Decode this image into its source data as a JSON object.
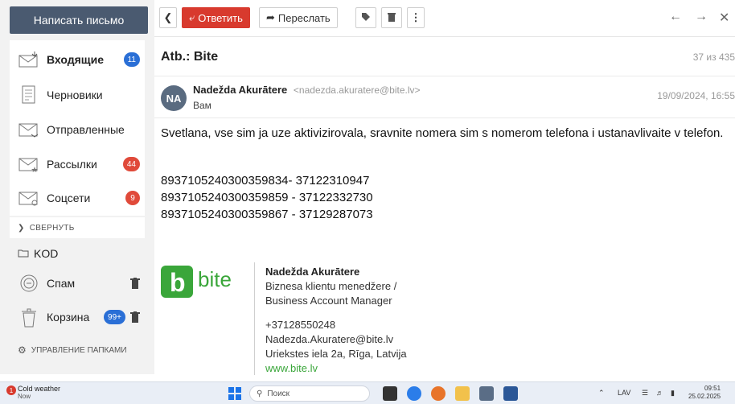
{
  "sidebar": {
    "compose_label": "Написать письмо",
    "folders": [
      {
        "label": "Входящие",
        "badge": "11",
        "badge_color": "#2a6fd6",
        "icon": "inbox-icon",
        "bold": true
      },
      {
        "label": "Черновики",
        "icon": "drafts-icon"
      },
      {
        "label": "Отправленные",
        "icon": "sent-icon"
      },
      {
        "label": "Рассылки",
        "badge": "44",
        "badge_color": "#e04a3a",
        "icon": "newsletters-icon"
      },
      {
        "label": "Соцсети",
        "badge": "9",
        "badge_color": "#e04a3a",
        "icon": "social-icon"
      }
    ],
    "collapse_label": "СВЕРНУТЬ",
    "custom_folder": "KOD",
    "spam_label": "Спам",
    "trash_label": "Корзина",
    "trash_badge": "99+",
    "manage_label": "УПРАВЛЕНИЕ ПАПКАМИ"
  },
  "toolbar": {
    "reply_label": "Ответить",
    "forward_label": "Переслать"
  },
  "message": {
    "subject": "Atb.: Bite",
    "counter": "37 из 435",
    "avatar_initials": "NA",
    "sender_name": "Nadežda Akurātere",
    "sender_email": "<nadezda.akuratere@bite.lv>",
    "to": "Вам",
    "date": "19/09/2024, 16:55",
    "body": "Svetlana, vse sim ja uze aktivizirovala, sravnite nomera sim s nomerom telefona i ustanavlivaite v telefon.",
    "sim_lines": [
      "8937105240300359834-  37122310947",
      "8937105240300359859 - 37122332730",
      "8937105240300359867 - 37129287073"
    ]
  },
  "signature": {
    "logo_text": "bite",
    "name": "Nadežda Akurātere",
    "title_lv": "Biznesa klientu menedžere /",
    "title_en": "Business Account Manager",
    "phone": "+37128550248",
    "email": "Nadezda.Akuratere@bite.lv",
    "address": "Uriekstes iela 2a, Rīga, Latvija",
    "website": "www.bite.lv",
    "brand_color": "#3aa63a"
  },
  "taskbar": {
    "weather_title": "Cold weather",
    "weather_sub": "Now",
    "weather_badge": "1",
    "search_placeholder": "Поиск",
    "lang": "LAV",
    "time": "09:51",
    "date": "25.02.2025"
  }
}
